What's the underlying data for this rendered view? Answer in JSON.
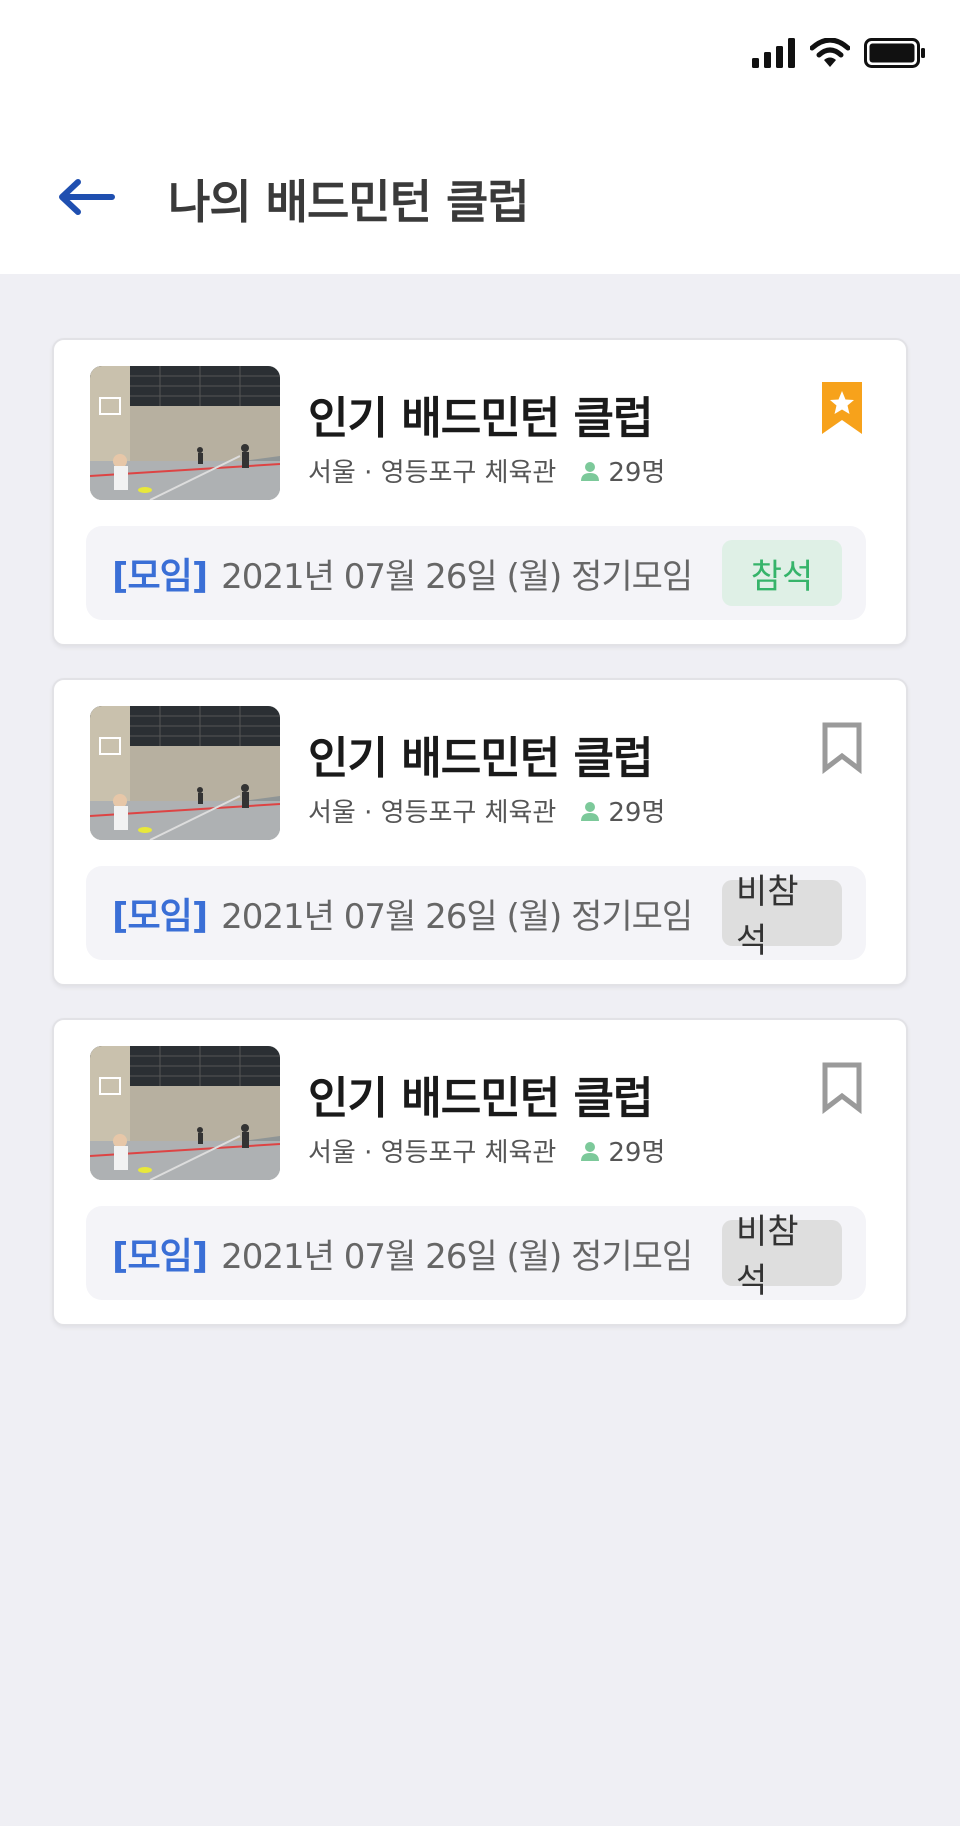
{
  "header": {
    "title": "나의 배드민턴 클럽"
  },
  "colors": {
    "accent": "#1f4fb0",
    "bookmark_active": "#f7a21b",
    "attend_green": "#36b46a",
    "tag_blue": "#3a6fd6"
  },
  "clubs": [
    {
      "name": "인기 배드민턴 클럽",
      "location": "서울 · 영등포구 체육관",
      "members": "29명",
      "bookmarked": true,
      "meeting_tag": "[모임]",
      "meeting_text": "2021년 07월 26일 (월) 정기모임",
      "attendance": "참석"
    },
    {
      "name": "인기 배드민턴 클럽",
      "location": "서울 · 영등포구 체육관",
      "members": "29명",
      "bookmarked": false,
      "meeting_tag": "[모임]",
      "meeting_text": "2021년 07월 26일 (월) 정기모임",
      "attendance": "비참석"
    },
    {
      "name": "인기 배드민턴 클럽",
      "location": "서울 · 영등포구 체육관",
      "members": "29명",
      "bookmarked": false,
      "meeting_tag": "[모임]",
      "meeting_text": "2021년 07월 26일 (월) 정기모임",
      "attendance": "비참석"
    }
  ]
}
